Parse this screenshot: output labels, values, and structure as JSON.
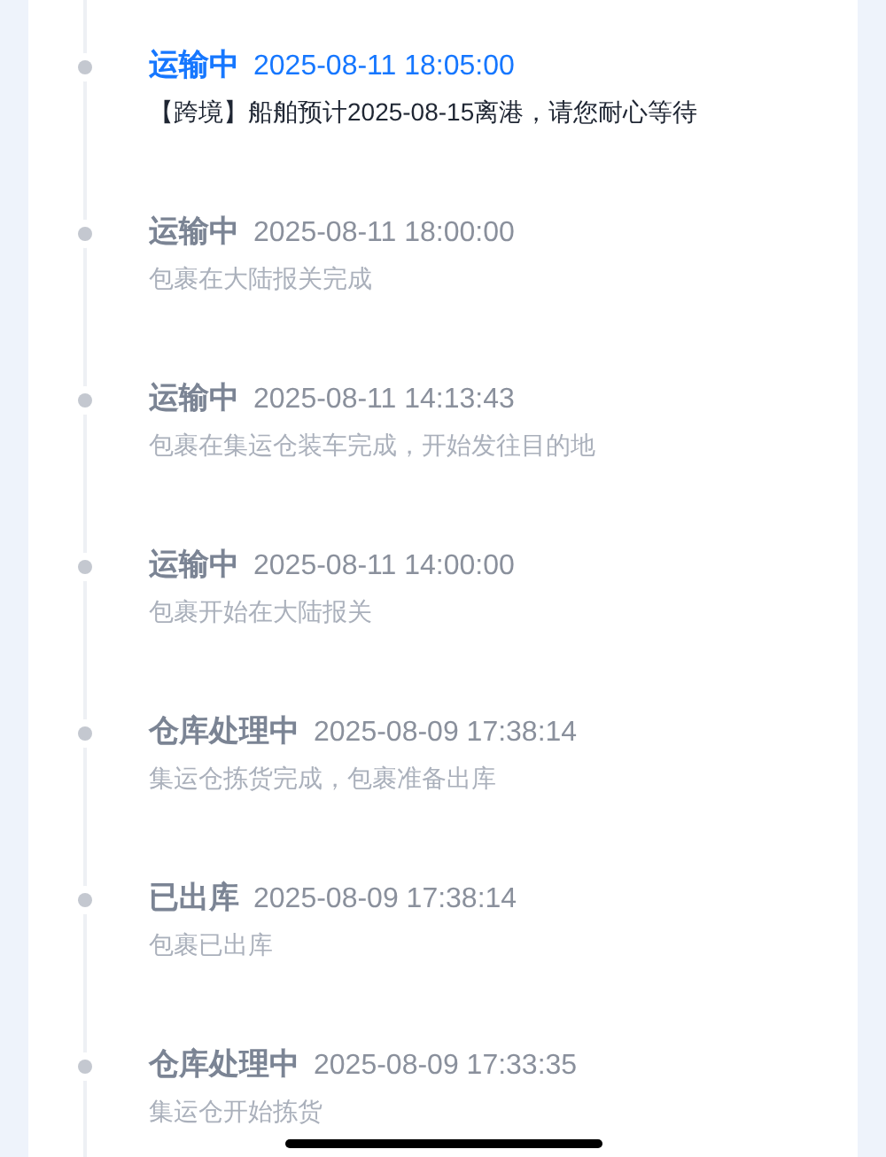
{
  "events": [
    {
      "status": "运输中",
      "time": "2025-08-11 18:05:00",
      "description": "【跨境】船舶预计2025-08-15离港，请您耐心等待",
      "current": true
    },
    {
      "status": "运输中",
      "time": "2025-08-11 18:00:00",
      "description": "包裹在大陆报关完成",
      "current": false
    },
    {
      "status": "运输中",
      "time": "2025-08-11 14:13:43",
      "description": "包裹在集运仓装车完成，开始发往目的地",
      "current": false
    },
    {
      "status": "运输中",
      "time": "2025-08-11 14:00:00",
      "description": "包裹开始在大陆报关",
      "current": false
    },
    {
      "status": "仓库处理中",
      "time": "2025-08-09 17:38:14",
      "description": "集运仓拣货完成，包裹准备出库",
      "current": false
    },
    {
      "status": "已出库",
      "time": "2025-08-09 17:38:14",
      "description": "包裹已出库",
      "current": false
    },
    {
      "status": "仓库处理中",
      "time": "2025-08-09 17:33:35",
      "description": "集运仓开始拣货",
      "current": false
    }
  ]
}
